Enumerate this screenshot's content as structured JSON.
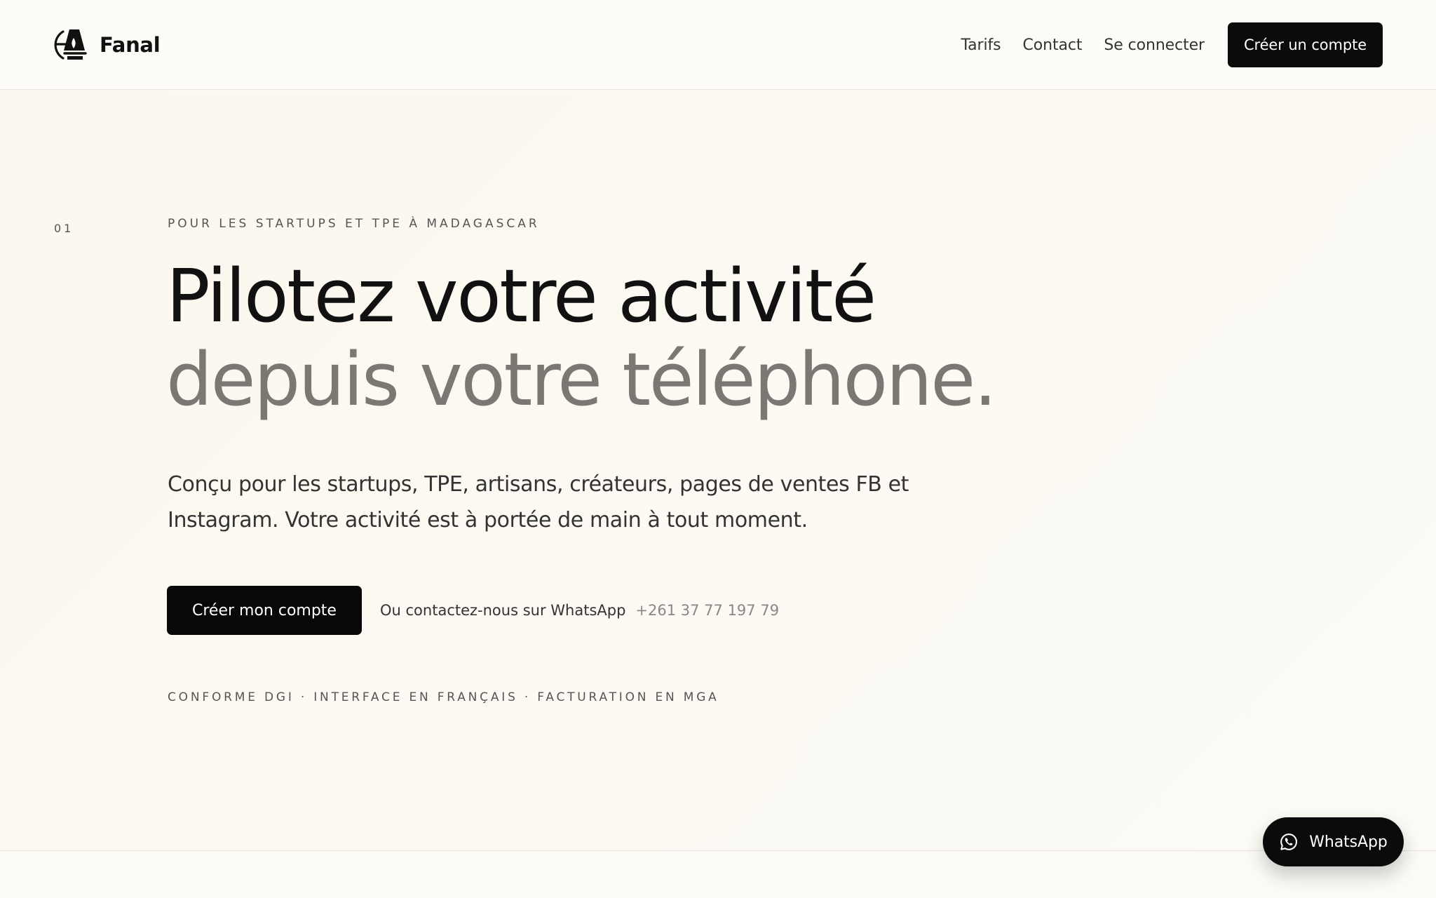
{
  "header": {
    "brand": "Fanal",
    "logo_icon": "lighthouse-logo",
    "nav": {
      "pricing": "Tarifs",
      "contact": "Contact",
      "login": "Se connecter",
      "cta": "Créer un compte"
    }
  },
  "hero": {
    "section_number": "01",
    "eyebrow": "POUR LES STARTUPS ET TPE À MADAGASCAR",
    "headline": {
      "line_1": "Pilotez votre activité",
      "line_2": "depuis votre téléphone."
    },
    "description": "Conçu pour les startups, TPE, artisans, créateurs, pages de ventes FB et Instagram. Votre activité est à portée de main à tout moment.",
    "primary_button": "Créer mon compte",
    "contact_text": "Ou contactez-nous sur WhatsApp",
    "phone": "+261 37 77 197 79",
    "badges": "CONFORME DGI · INTERFACE EN FRANÇAIS · FACTURATION EN MGA"
  },
  "floating_button": {
    "icon": "whatsapp-icon",
    "label": "WhatsApp"
  },
  "colors": {
    "background": "#fcfaf4",
    "text_primary": "#111111",
    "text_secondary": "#7b7874",
    "button_background": "#0b0b0b",
    "button_text": "#ffffff"
  }
}
